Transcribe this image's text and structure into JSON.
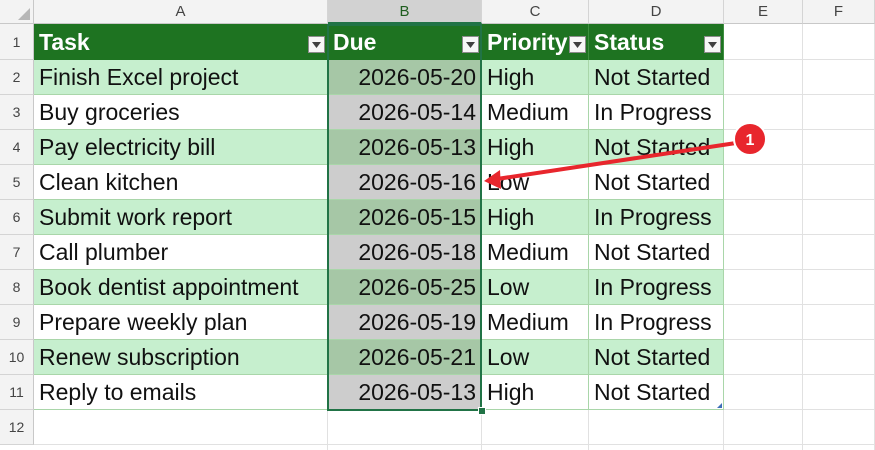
{
  "columns": [
    "A",
    "B",
    "C",
    "D",
    "E",
    "F"
  ],
  "rows": [
    "1",
    "2",
    "3",
    "4",
    "5",
    "6",
    "7",
    "8",
    "9",
    "10",
    "11",
    "12"
  ],
  "table": {
    "headers": [
      "Task",
      "Due",
      "Priority",
      "Status"
    ],
    "data": [
      [
        "Finish Excel project",
        "2026-05-20",
        "High",
        "Not Started"
      ],
      [
        "Buy groceries",
        "2026-05-14",
        "Medium",
        "In Progress"
      ],
      [
        "Pay electricity bill",
        "2026-05-13",
        "High",
        "Not Started"
      ],
      [
        "Clean kitchen",
        "2026-05-16",
        "Low",
        "Not Started"
      ],
      [
        "Submit work report",
        "2026-05-15",
        "High",
        "In Progress"
      ],
      [
        "Call plumber",
        "2026-05-18",
        "Medium",
        "Not Started"
      ],
      [
        "Book dentist appointment",
        "2026-05-25",
        "Low",
        "In Progress"
      ],
      [
        "Prepare weekly plan",
        "2026-05-19",
        "Medium",
        "In Progress"
      ],
      [
        "Renew subscription",
        "2026-05-21",
        "Low",
        "Not Started"
      ],
      [
        "Reply to emails",
        "2026-05-13",
        "High",
        "Not Started"
      ]
    ]
  },
  "annotation": {
    "badge": "1"
  },
  "colors": {
    "header_fill": "#1e7321",
    "band_fill": "#c6efce",
    "selection": "#217346",
    "annotation_red": "#e8262d"
  },
  "icons": {
    "filter": "filter-dropdown-icon"
  }
}
